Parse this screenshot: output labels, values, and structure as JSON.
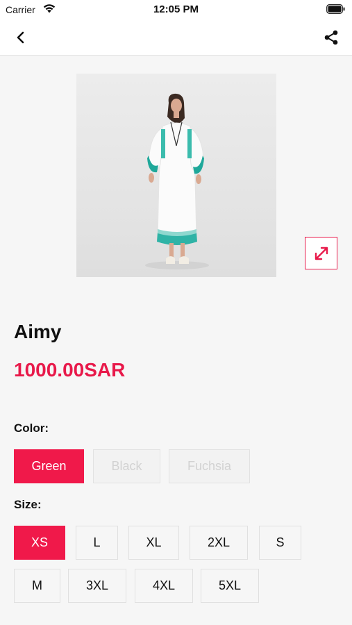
{
  "status_bar": {
    "carrier": "Carrier",
    "time": "12:05 PM"
  },
  "nav": {
    "back_icon": "chevron-left-icon",
    "share_icon": "share-icon"
  },
  "product": {
    "name": "Aimy",
    "price": "1000.00SAR",
    "image_description_icon": "product-photo",
    "expand_icon": "expand-icon"
  },
  "colors": {
    "label": "Color:",
    "options": [
      {
        "label": "Green",
        "state": "selected"
      },
      {
        "label": "Black",
        "state": "disabled"
      },
      {
        "label": "Fuchsia",
        "state": "disabled"
      }
    ]
  },
  "sizes": {
    "label": "Size:",
    "options": [
      {
        "label": "XS",
        "state": "selected"
      },
      {
        "label": "L",
        "state": "normal"
      },
      {
        "label": "XL",
        "state": "normal"
      },
      {
        "label": "2XL",
        "state": "normal"
      },
      {
        "label": "S",
        "state": "normal"
      },
      {
        "label": "M",
        "state": "normal"
      },
      {
        "label": "3XL",
        "state": "normal"
      },
      {
        "label": "4XL",
        "state": "normal"
      },
      {
        "label": "5XL",
        "state": "normal"
      }
    ]
  },
  "theme": {
    "accent": "#f0194a",
    "background": "#f6f6f6"
  }
}
